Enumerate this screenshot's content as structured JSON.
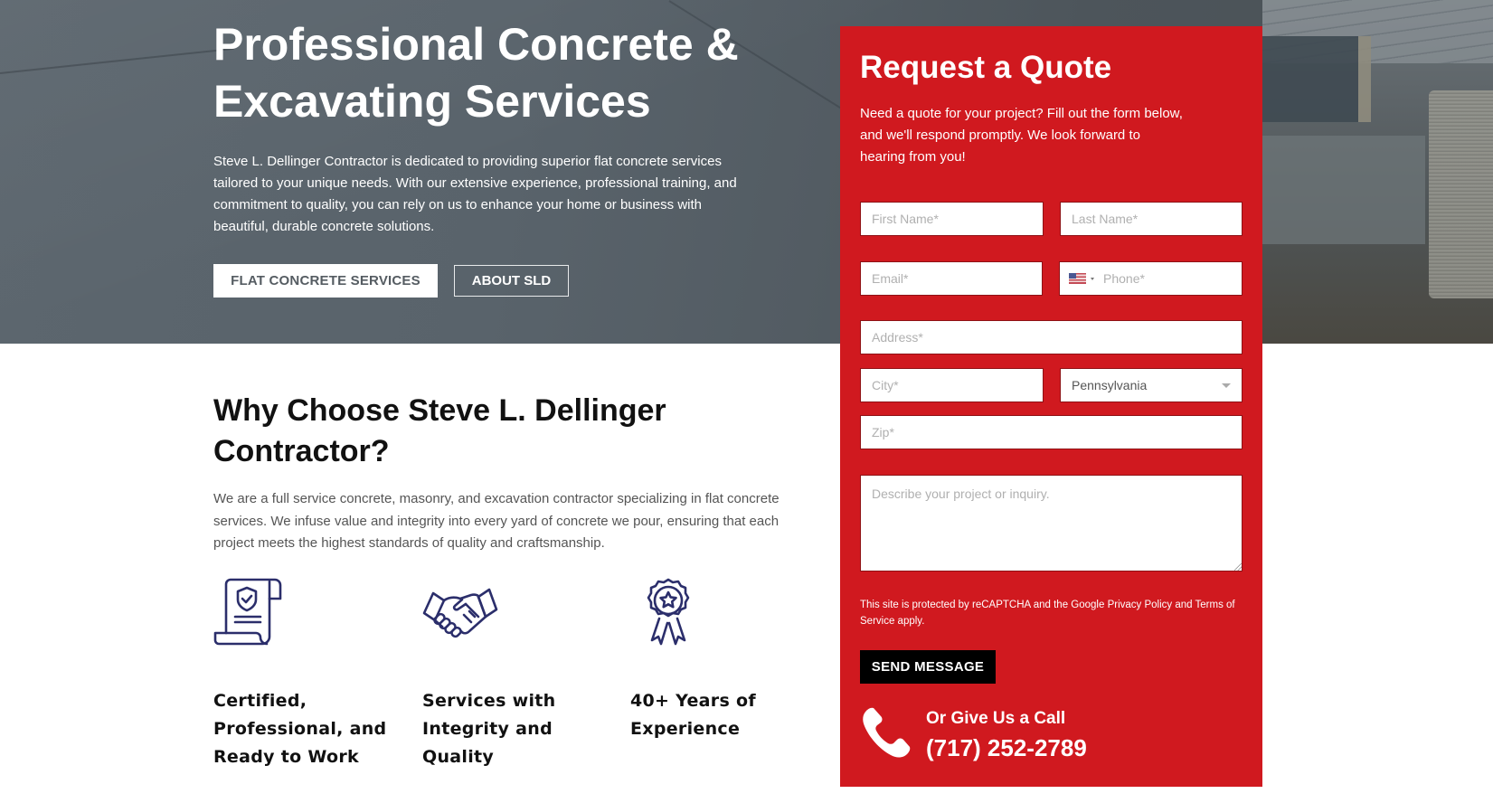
{
  "hero": {
    "title": "Professional Concrete & Excavating Services",
    "description": "Steve L. Dellinger Contractor is dedicated to providing superior flat concrete services tailored to your unique needs. With our extensive experience, professional training, and commitment to quality, you can rely on us to enhance your home or business with beautiful, durable concrete solutions.",
    "buttons": {
      "primary": "FLAT CONCRETE SERVICES",
      "secondary": "ABOUT SLD"
    }
  },
  "why": {
    "title": "Why Choose Steve L. Dellinger Contractor?",
    "description": "We are a full service concrete, masonry, and excavation contractor specializing in flat concrete services. We infuse value and integrity into every yard of concrete we pour, ensuring that each project meets the highest standards of quality and craftsmanship.",
    "features": [
      {
        "icon": "certificate-shield-icon",
        "label": "Certified, Professional, and Ready to Work"
      },
      {
        "icon": "handshake-icon",
        "label": "Services with Integrity and Quality"
      },
      {
        "icon": "award-ribbon-icon",
        "label": "40+ Years of Experience"
      }
    ],
    "icon_color": "#2b2e6b"
  },
  "quote_form": {
    "title": "Request a Quote",
    "description": "Need a quote for your project? Fill out the form below, and we'll respond promptly. We look forward to hearing from you!",
    "fields": {
      "first_name": {
        "placeholder": "First Name*",
        "value": ""
      },
      "last_name": {
        "placeholder": "Last Name*",
        "value": ""
      },
      "email": {
        "placeholder": "Email*",
        "value": ""
      },
      "phone": {
        "placeholder": "Phone*",
        "value": "",
        "country": "US"
      },
      "address": {
        "placeholder": "Address*",
        "value": ""
      },
      "city": {
        "placeholder": "City*",
        "value": ""
      },
      "state": {
        "selected": "Pennsylvania"
      },
      "zip": {
        "placeholder": "Zip*",
        "value": ""
      },
      "message": {
        "placeholder": "Describe your project or inquiry.",
        "value": ""
      }
    },
    "recaptcha": {
      "prefix": "This site is protected by reCAPTCHA and the Google ",
      "privacy_link": "Privacy Policy",
      "middle": " and ",
      "terms_link": "Terms of Service",
      "suffix": " apply."
    },
    "submit_label": "SEND MESSAGE",
    "call": {
      "label": "Or Give Us a Call",
      "phone_number": "(717) 252-2789"
    },
    "accent_color": "#d0191f"
  }
}
